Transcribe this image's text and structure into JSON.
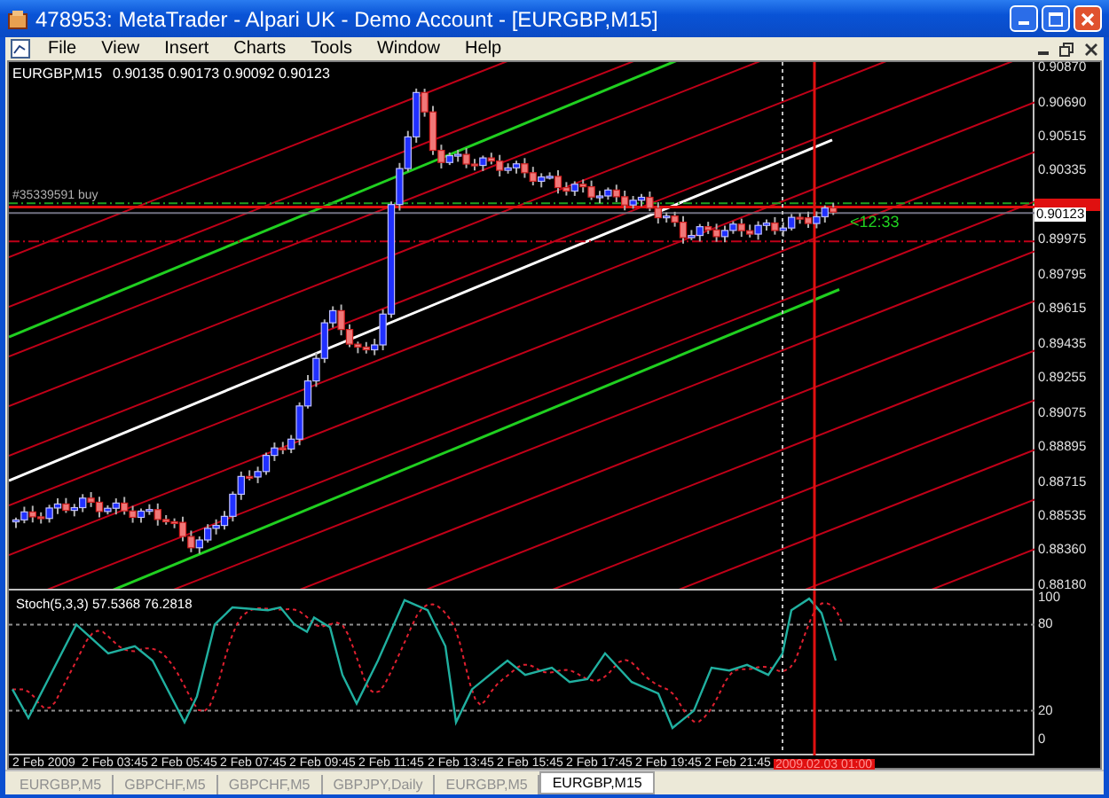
{
  "window": {
    "title": "478953: MetaTrader - Alpari UK - Demo Account - [EURGBP,M15]"
  },
  "menu": [
    "File",
    "View",
    "Insert",
    "Charts",
    "Tools",
    "Window",
    "Help"
  ],
  "chart": {
    "symbol": "EURGBP,M15",
    "ohlc": "0.90135 0.90173 0.90092 0.90123",
    "order_label": "#35339591 buy",
    "timer": "<12:33",
    "bid_label": "0.90123",
    "price_axis": [
      "0.90870",
      "0.90690",
      "0.90515",
      "0.90335",
      "0.89975",
      "0.89795",
      "0.89615",
      "0.89435",
      "0.89255",
      "0.89075",
      "0.88895",
      "0.88715",
      "0.88535",
      "0.88360",
      "0.88180"
    ]
  },
  "indicator": {
    "header": "Stoch(5,3,3) 57.5368 76.2818",
    "axis": [
      "100",
      "80",
      "20",
      "0"
    ]
  },
  "time_axis": [
    "2 Feb 2009",
    "2 Feb 03:45",
    "2 Feb 05:45",
    "2 Feb 07:45",
    "2 Feb 09:45",
    "2 Feb 11:45",
    "2 Feb 13:45",
    "2 Feb 15:45",
    "2 Feb 17:45",
    "2 Feb 19:45",
    "2 Feb 21:45"
  ],
  "cursor_time": "2009.02.03 01:00",
  "tabs": [
    {
      "label": "EURGBP,M5",
      "selected": false
    },
    {
      "label": "GBPCHF,M5",
      "selected": false
    },
    {
      "label": "GBPCHF,M5",
      "selected": false
    },
    {
      "label": "GBPJPY,Daily",
      "selected": false
    },
    {
      "label": "EURGBP,M5",
      "selected": false
    },
    {
      "label": "EURGBP,M15",
      "selected": true
    }
  ]
}
